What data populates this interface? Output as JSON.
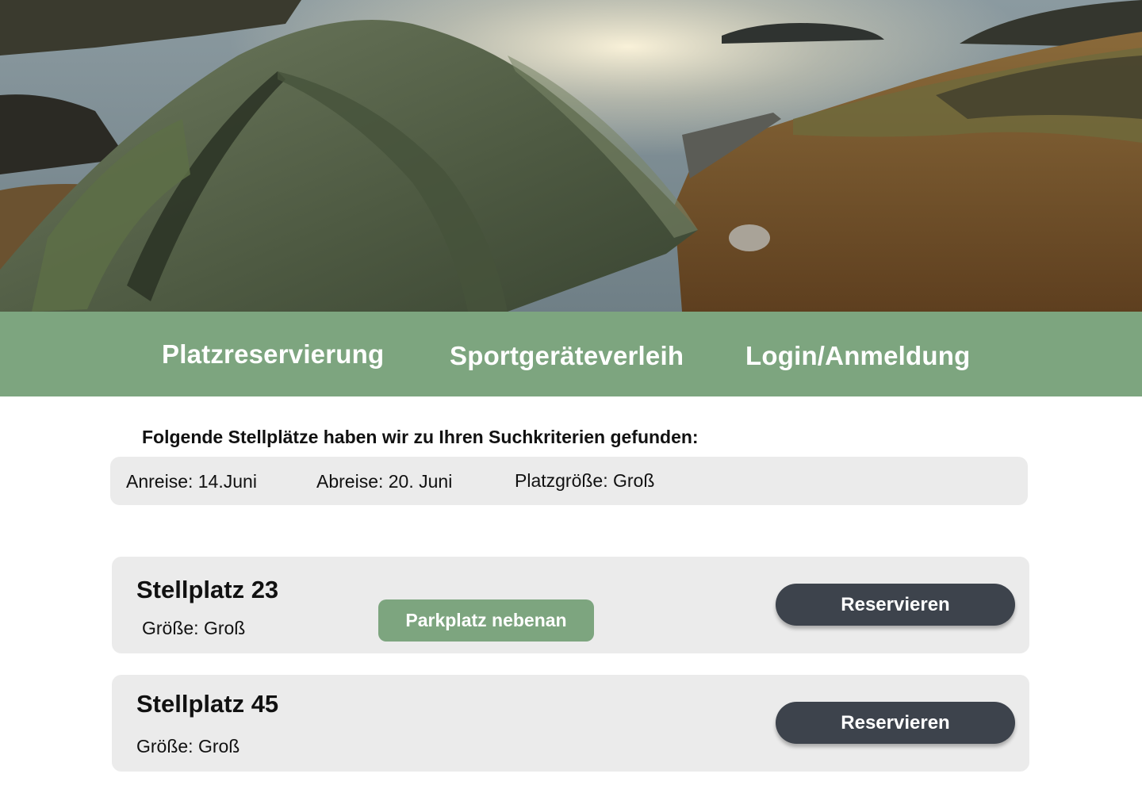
{
  "hero": {
    "image": "camping-tent-lake-photo"
  },
  "nav": {
    "items": [
      {
        "label": "Platzreservierung"
      },
      {
        "label": "Sportgeräteverleih"
      },
      {
        "label": "Login/Anmeldung"
      }
    ]
  },
  "results": {
    "heading": "Folgende Stellplätze haben wir zu Ihren Suchkriterien gefunden:",
    "criteria": {
      "arrival": "Anreise: 14.Juni",
      "departure": "Abreise: 20. Juni",
      "size": "Platzgröße: Groß"
    }
  },
  "spots": [
    {
      "title": "Stellplatz 23",
      "size": "Größe: Groß",
      "tag": "Parkplatz nebenan",
      "button": "Reservieren"
    },
    {
      "title": "Stellplatz 45",
      "size": "Größe: Groß",
      "button": "Reservieren"
    }
  ],
  "colors": {
    "nav_bg": "#7da57f",
    "tag_bg": "#7da57f",
    "button_bg": "#3d434c",
    "card_bg": "#ebebeb"
  }
}
